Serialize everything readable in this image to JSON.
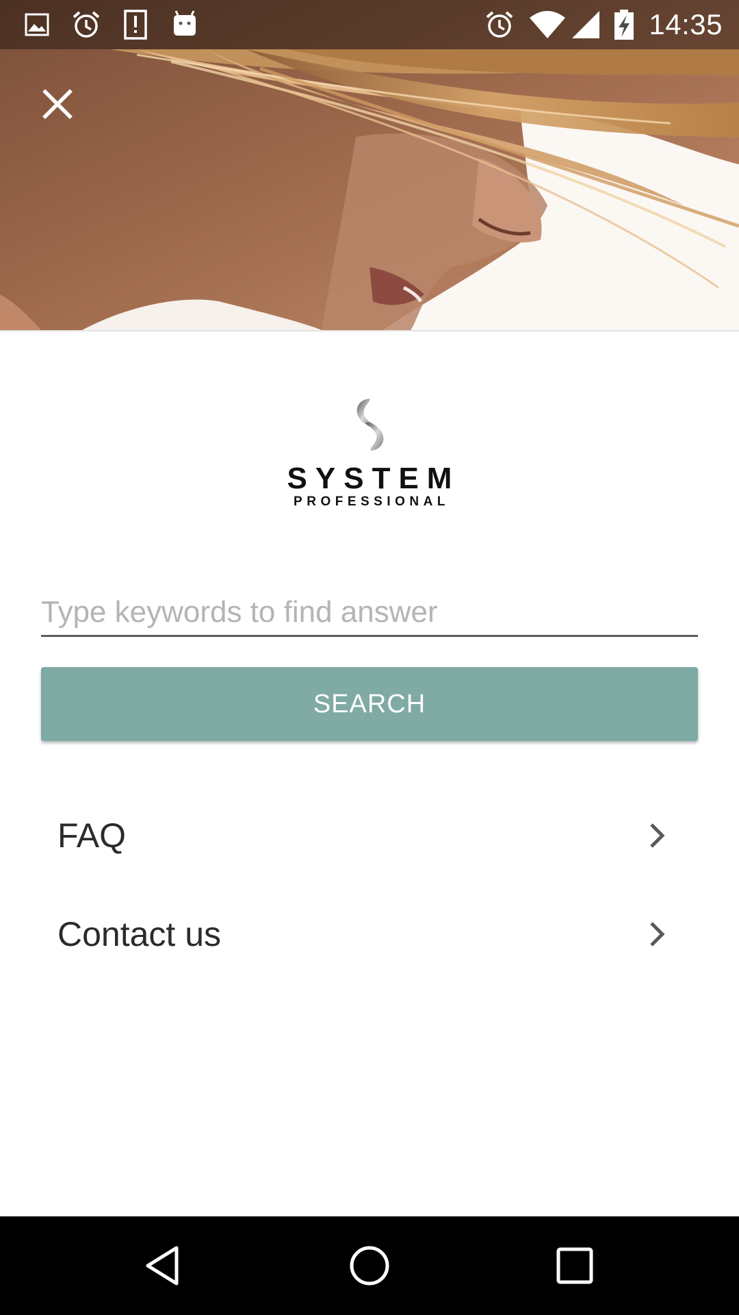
{
  "status_bar": {
    "time": "14:35",
    "left_icons": [
      "image-notification-icon",
      "alarm-notification-icon",
      "alert-notification-icon",
      "android-notification-icon"
    ],
    "right_icons": [
      "alarm-icon",
      "wifi-icon",
      "cell-signal-icon",
      "battery-charging-icon"
    ]
  },
  "hero": {
    "image": "hero-photo",
    "close_icon": "close-icon"
  },
  "logo": {
    "title": "SYSTEM",
    "subtitle": "PROFESSIONAL"
  },
  "search": {
    "placeholder": "Type keywords to find answer",
    "value": "",
    "button_label": "SEARCH",
    "button_color": "#80aaa4"
  },
  "menu": {
    "items": [
      {
        "label": "FAQ",
        "icon": "chevron-right-icon"
      },
      {
        "label": "Contact us",
        "icon": "chevron-right-icon"
      }
    ]
  },
  "nav_bar": {
    "buttons": [
      "back-icon",
      "home-icon",
      "recents-icon"
    ]
  }
}
